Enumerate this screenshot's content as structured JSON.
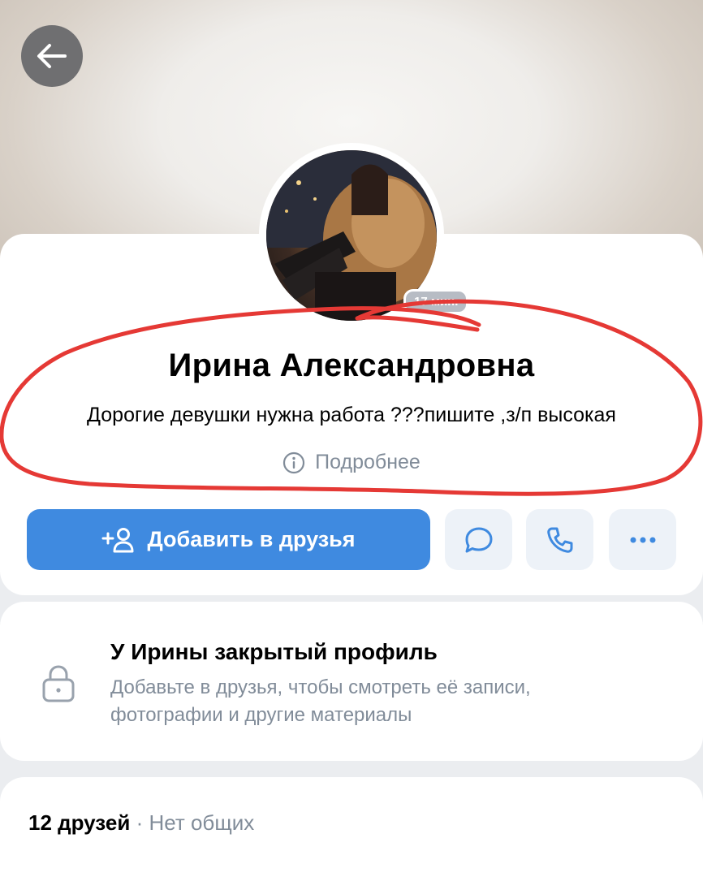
{
  "header": {
    "back_icon": "arrow-left-icon"
  },
  "profile": {
    "name": "Ирина Александровна",
    "status": "Дорогие девушки нужна работа ???пишите ,з/п высокая",
    "online_badge": "17 мин.",
    "more_info_label": "Подробнее",
    "more_info_icon": "info-circle-icon"
  },
  "actions": {
    "add_friend_label": "Добавить в друзья",
    "add_friend_icon": "add-friend-icon",
    "message_icon": "message-bubble-icon",
    "call_icon": "phone-icon",
    "more_icon": "more-dots-icon"
  },
  "closed_profile": {
    "icon": "lock-icon",
    "title": "У Ирины закрытый профиль",
    "description": "Добавьте в друзья, чтобы смотреть её записи, фотографии и другие материалы"
  },
  "friends": {
    "count_label": "12 друзей",
    "separator": "·",
    "mutual_label": "Нет общих"
  },
  "colors": {
    "accent": "#3f8ae0",
    "secondary_text": "#818c99",
    "secondary_button_bg": "#edf2f8",
    "annotation_red": "#e53935"
  }
}
